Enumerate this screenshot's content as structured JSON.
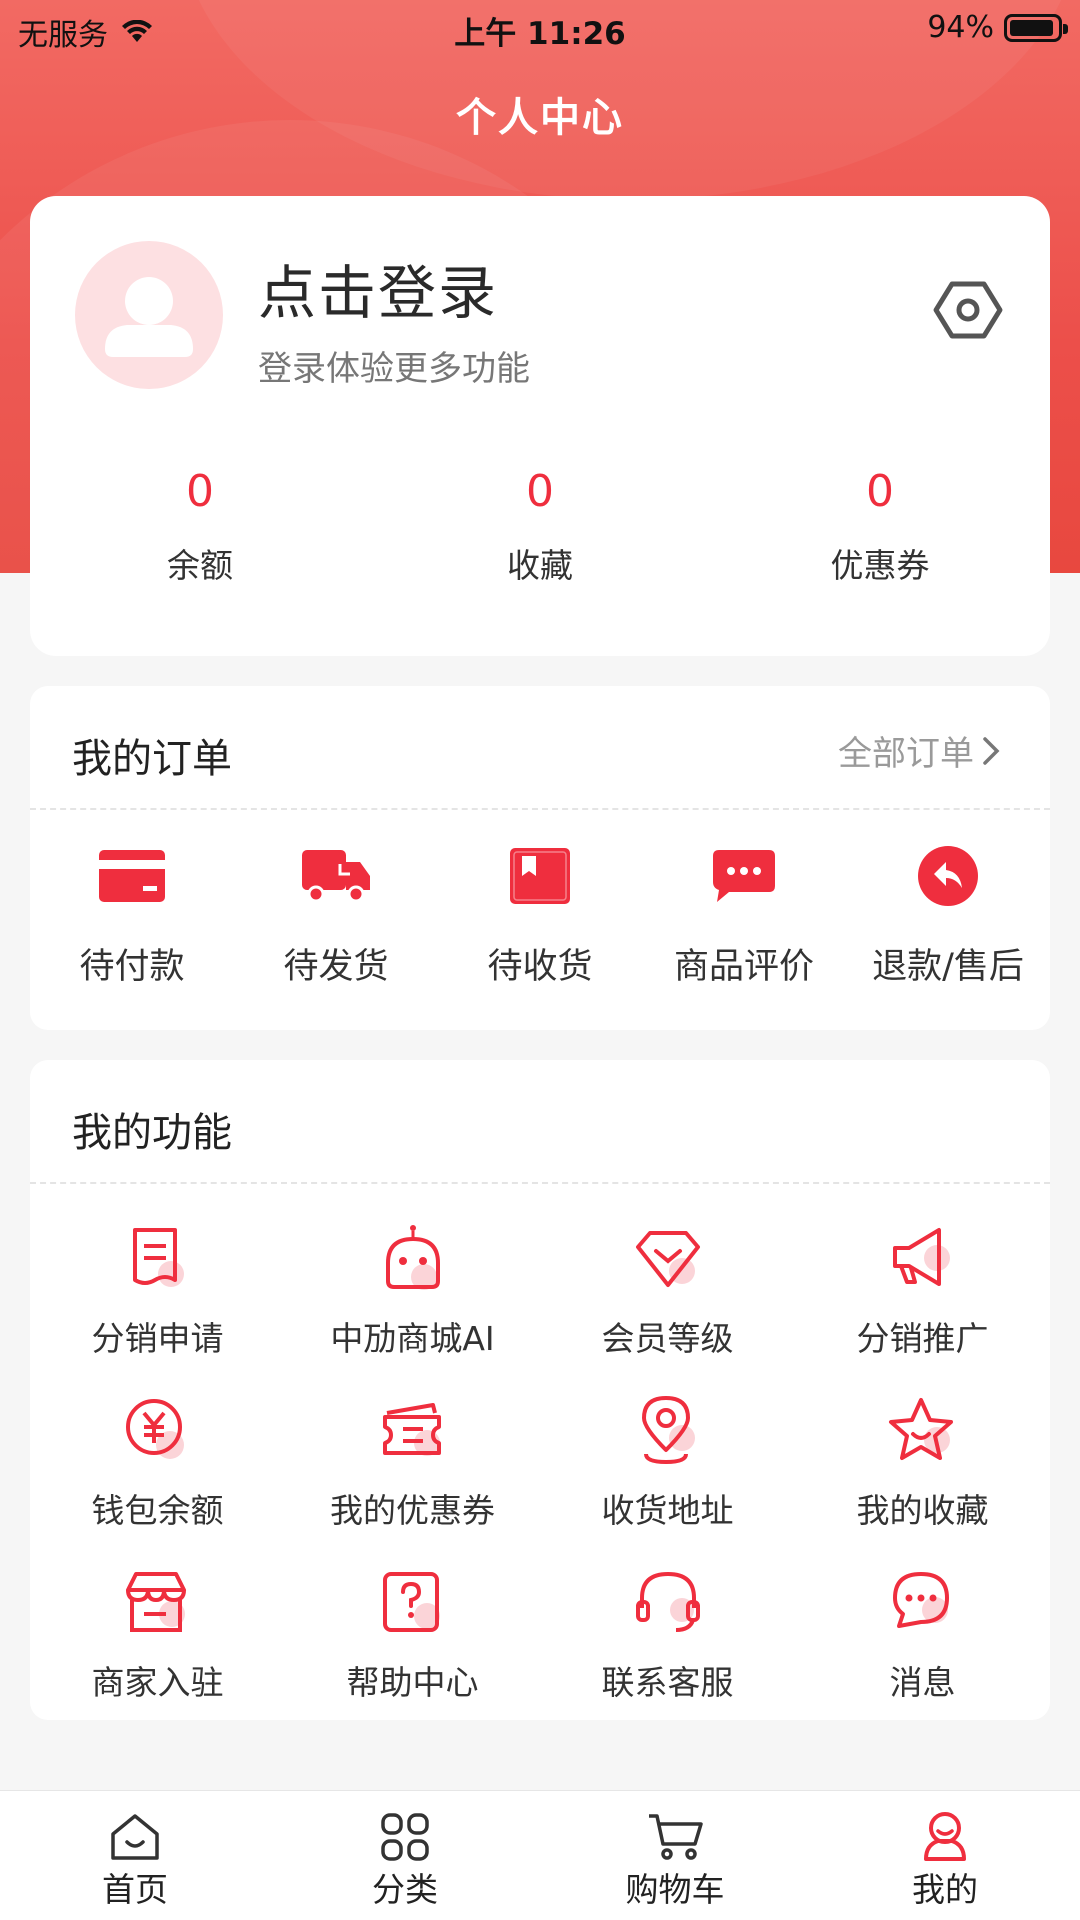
{
  "status_bar": {
    "carrier": "无服务",
    "time": "上午 11:26",
    "battery": "94%"
  },
  "nav": {
    "title": "个人中心"
  },
  "profile": {
    "login_title": "点击登录",
    "login_subtitle": "登录体验更多功能",
    "stats": [
      {
        "value": "0",
        "label": "余额"
      },
      {
        "value": "0",
        "label": "收藏"
      },
      {
        "value": "0",
        "label": "优惠券"
      }
    ]
  },
  "orders": {
    "title": "我的订单",
    "all_link": "全部订单",
    "items": [
      {
        "label": "待付款",
        "icon": "card-icon"
      },
      {
        "label": "待发货",
        "icon": "truck-icon"
      },
      {
        "label": "待收货",
        "icon": "package-icon"
      },
      {
        "label": "商品评价",
        "icon": "comment-icon"
      },
      {
        "label": "退款/售后",
        "icon": "return-icon"
      }
    ]
  },
  "functions": {
    "title": "我的功能",
    "items": [
      {
        "label": "分销申请",
        "icon": "document-icon"
      },
      {
        "label": "中劢商城AI",
        "icon": "robot-icon"
      },
      {
        "label": "会员等级",
        "icon": "diamond-icon"
      },
      {
        "label": "分销推广",
        "icon": "megaphone-icon"
      },
      {
        "label": "钱包余额",
        "icon": "yen-coin-icon"
      },
      {
        "label": "我的优惠券",
        "icon": "ticket-icon"
      },
      {
        "label": "收货地址",
        "icon": "location-pin-icon"
      },
      {
        "label": "我的收藏",
        "icon": "star-icon"
      },
      {
        "label": "商家入驻",
        "icon": "store-icon"
      },
      {
        "label": "帮助中心",
        "icon": "help-icon"
      },
      {
        "label": "联系客服",
        "icon": "headset-icon"
      },
      {
        "label": "消息",
        "icon": "message-icon"
      }
    ]
  },
  "tabbar": {
    "items": [
      {
        "label": "首页",
        "icon": "home-icon"
      },
      {
        "label": "分类",
        "icon": "grid-icon"
      },
      {
        "label": "购物车",
        "icon": "cart-icon"
      },
      {
        "label": "我的",
        "icon": "user-icon",
        "active": true
      }
    ]
  },
  "colors": {
    "brand": "#ef2e3e",
    "hero": "#ec4f4a",
    "accent_light": "#fbd4d8"
  }
}
